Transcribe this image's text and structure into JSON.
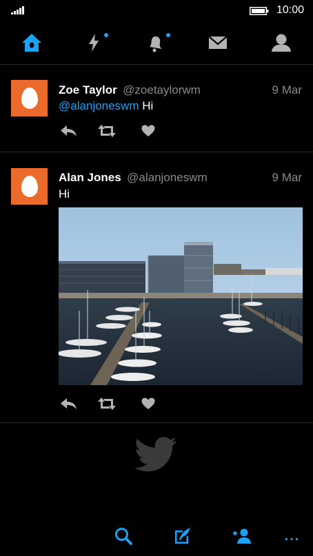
{
  "status": {
    "time": "10:00"
  },
  "nav": {
    "items": [
      {
        "name": "home",
        "active": true,
        "icon": "home-icon"
      },
      {
        "name": "moments",
        "active": false,
        "icon": "lightning-icon",
        "has_dot": true
      },
      {
        "name": "notifications",
        "active": false,
        "icon": "bell-icon",
        "has_dot": true
      },
      {
        "name": "messages",
        "active": false,
        "icon": "envelope-icon"
      },
      {
        "name": "profile",
        "active": false,
        "icon": "person-icon"
      }
    ]
  },
  "tweets": [
    {
      "name": "Zoe Taylor",
      "handle": "@zoetaylorwm",
      "date": "9 Mar",
      "mention": "@alanjoneswm",
      "text": " Hi"
    },
    {
      "name": "Alan Jones",
      "handle": "@alanjoneswm",
      "date": "9 Mar",
      "text": "Hi",
      "has_photo": true
    }
  ],
  "bottom_bar": {
    "more_label": "..."
  },
  "colors": {
    "accent": "#1da1f2",
    "avatar_bg": "#ea6b2b",
    "muted": "#8a8a8a",
    "divider": "#2b2b2b",
    "icon_inactive": "#b3b3b3"
  }
}
